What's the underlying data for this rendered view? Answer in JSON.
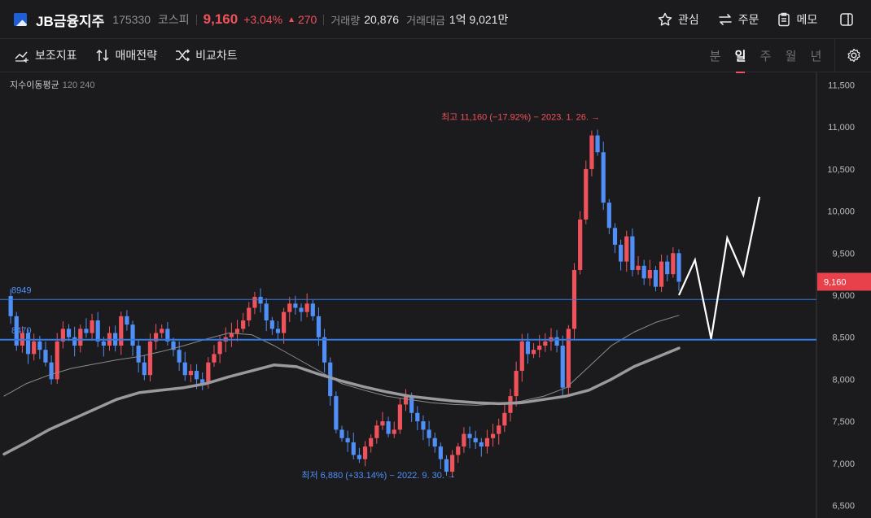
{
  "stock": {
    "name": "JB금융지주",
    "code": "175330",
    "market": "코스피",
    "price": "9,160",
    "change_pct": "+3.04%",
    "change_arrow": "▲",
    "change_abs": "270",
    "volume_label": "거래량",
    "volume": "20,876",
    "value_label": "거래대금",
    "value": "1억 9,021만"
  },
  "header_actions": {
    "watch": "관심",
    "order": "주문",
    "memo": "메모"
  },
  "toolbar": {
    "indicators": "보조지표",
    "strategy": "매매전략",
    "compare": "비교차트",
    "periods": [
      "분",
      "일",
      "주",
      "월",
      "년"
    ],
    "active_period": "일"
  },
  "legend": {
    "label": "지수이동평균",
    "params": "120 240"
  },
  "colors": {
    "background": "#1b1b1d",
    "up": "#f0525b",
    "down": "#4f8ff7",
    "line": "#2f7be8",
    "ema120": "#8c8c90",
    "ema240": "#9a9a9e",
    "projection": "#ffffff"
  },
  "chart_data": {
    "type": "candlestick",
    "period": "daily",
    "y_axis": {
      "ticks": [
        6500,
        7000,
        7500,
        8000,
        8500,
        9000,
        9500,
        10000,
        10500,
        11000,
        11500
      ],
      "tick_labels": [
        "6,500",
        "7,000",
        "7,500",
        "8,000",
        "8,500",
        "9,000",
        "9,500",
        "10,000",
        "10,500",
        "11,000",
        "11,500"
      ],
      "ylim": [
        6350,
        11650
      ]
    },
    "current_price": 9160,
    "current_price_label": "9,160",
    "horizontal_lines": [
      {
        "value": 8949,
        "label": "8949"
      },
      {
        "value": 8470,
        "label": "8470"
      }
    ],
    "annotations": {
      "high": {
        "value": 11160,
        "text": "최고 11,160 (−17.92%) − 2023. 1. 26. →"
      },
      "low": {
        "value": 6880,
        "text": "최저 6,880 (+33.14%) − 2022. 9. 30. →"
      }
    },
    "close_series": [
      8990,
      8750,
      8400,
      8550,
      8300,
      8450,
      8350,
      8200,
      8000,
      8450,
      8600,
      8500,
      8400,
      8600,
      8550,
      8700,
      8450,
      8400,
      8550,
      8400,
      8750,
      8650,
      8400,
      8200,
      8050,
      8450,
      8550,
      8600,
      8450,
      8350,
      8200,
      8050,
      8100,
      8000,
      7950,
      8200,
      8300,
      8450,
      8500,
      8550,
      8600,
      8700,
      8850,
      8980,
      8900,
      8700,
      8600,
      8550,
      8800,
      8900,
      8850,
      8800,
      8900,
      8750,
      8500,
      8200,
      7800,
      7400,
      7300,
      7250,
      7100,
      7050,
      7200,
      7300,
      7450,
      7500,
      7350,
      7400,
      7700,
      7800,
      7600,
      7500,
      7400,
      7300,
      7200,
      7050,
      6900,
      7100,
      7200,
      7350,
      7300,
      7250,
      7200,
      7300,
      7350,
      7450,
      7600,
      7800,
      8100,
      8450,
      8300,
      8350,
      8400,
      8450,
      8500,
      8400,
      7900,
      8600,
      9300,
      9900,
      10500,
      10900,
      10700,
      10100,
      9800,
      9600,
      9400,
      9700,
      9300,
      9350,
      9200,
      9300,
      9100,
      9400,
      9250,
      9500,
      9160
    ],
    "ema120_series": [
      7800,
      7950,
      8050,
      8130,
      8180,
      8230,
      8270,
      8330,
      8400,
      8480,
      8550,
      8530,
      8400,
      8250,
      8100,
      7950,
      7870,
      7800,
      7760,
      7720,
      7700,
      7690,
      7710,
      7740,
      7800,
      7900,
      8150,
      8400,
      8560,
      8680,
      8760
    ],
    "ema240_series": [
      7110,
      7250,
      7400,
      7520,
      7640,
      7760,
      7840,
      7870,
      7900,
      7950,
      8030,
      8100,
      8170,
      8150,
      8060,
      7980,
      7910,
      7850,
      7800,
      7770,
      7740,
      7720,
      7710,
      7720,
      7760,
      7800,
      7870,
      8000,
      8150,
      8260,
      8370
    ],
    "projection_path": [
      9000,
      9420,
      8480,
      9680,
      9240,
      10170
    ]
  }
}
